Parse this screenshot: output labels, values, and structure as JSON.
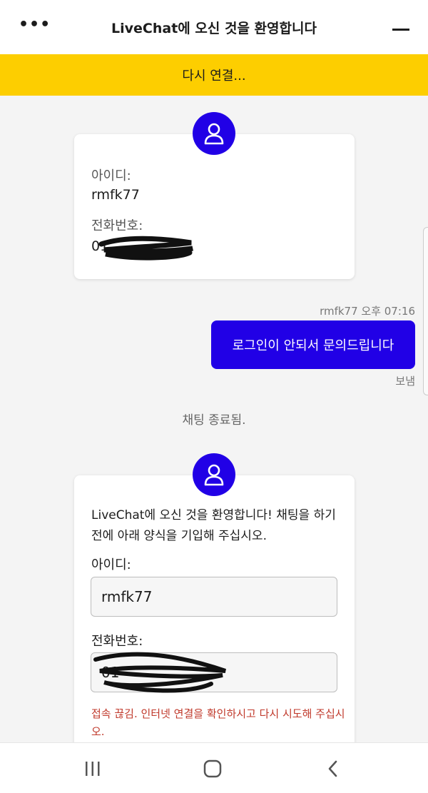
{
  "header": {
    "menu_glyph": "•••",
    "title": "LiveChat에 오신 것을 환영합니다"
  },
  "banner": {
    "text": "다시 연결..."
  },
  "card1": {
    "id_label": "아이디:",
    "id_value": "rmfk77",
    "phone_label": "전화번호:",
    "phone_value_visible": "01"
  },
  "message": {
    "meta": "rmfk77 오후 07:16",
    "text": "로그인이 안되서 문의드립니다",
    "status": "보냄"
  },
  "chat_ended": "채팅 종료됨.",
  "form": {
    "intro": "LiveChat에 오신 것을 환영합니다! 채팅을 하기 전에 아래 양식을 기입해 주십시오.",
    "id_label": "아이디:",
    "id_value": "rmfk77",
    "phone_label": "전화번호:",
    "phone_value_visible": "01",
    "error": "접속 끊김. 인터넷 연결을 확인하시고 다시 시도해 주십시오."
  },
  "colors": {
    "accent": "#2100e6",
    "banner": "#fdce00",
    "error": "#c0392b"
  },
  "icons": {
    "menu": "more-dots-icon",
    "minimize": "minimize-icon",
    "avatar": "user-icon",
    "nav_recent": "recent-apps-icon",
    "nav_home": "home-icon",
    "nav_back": "back-icon"
  }
}
